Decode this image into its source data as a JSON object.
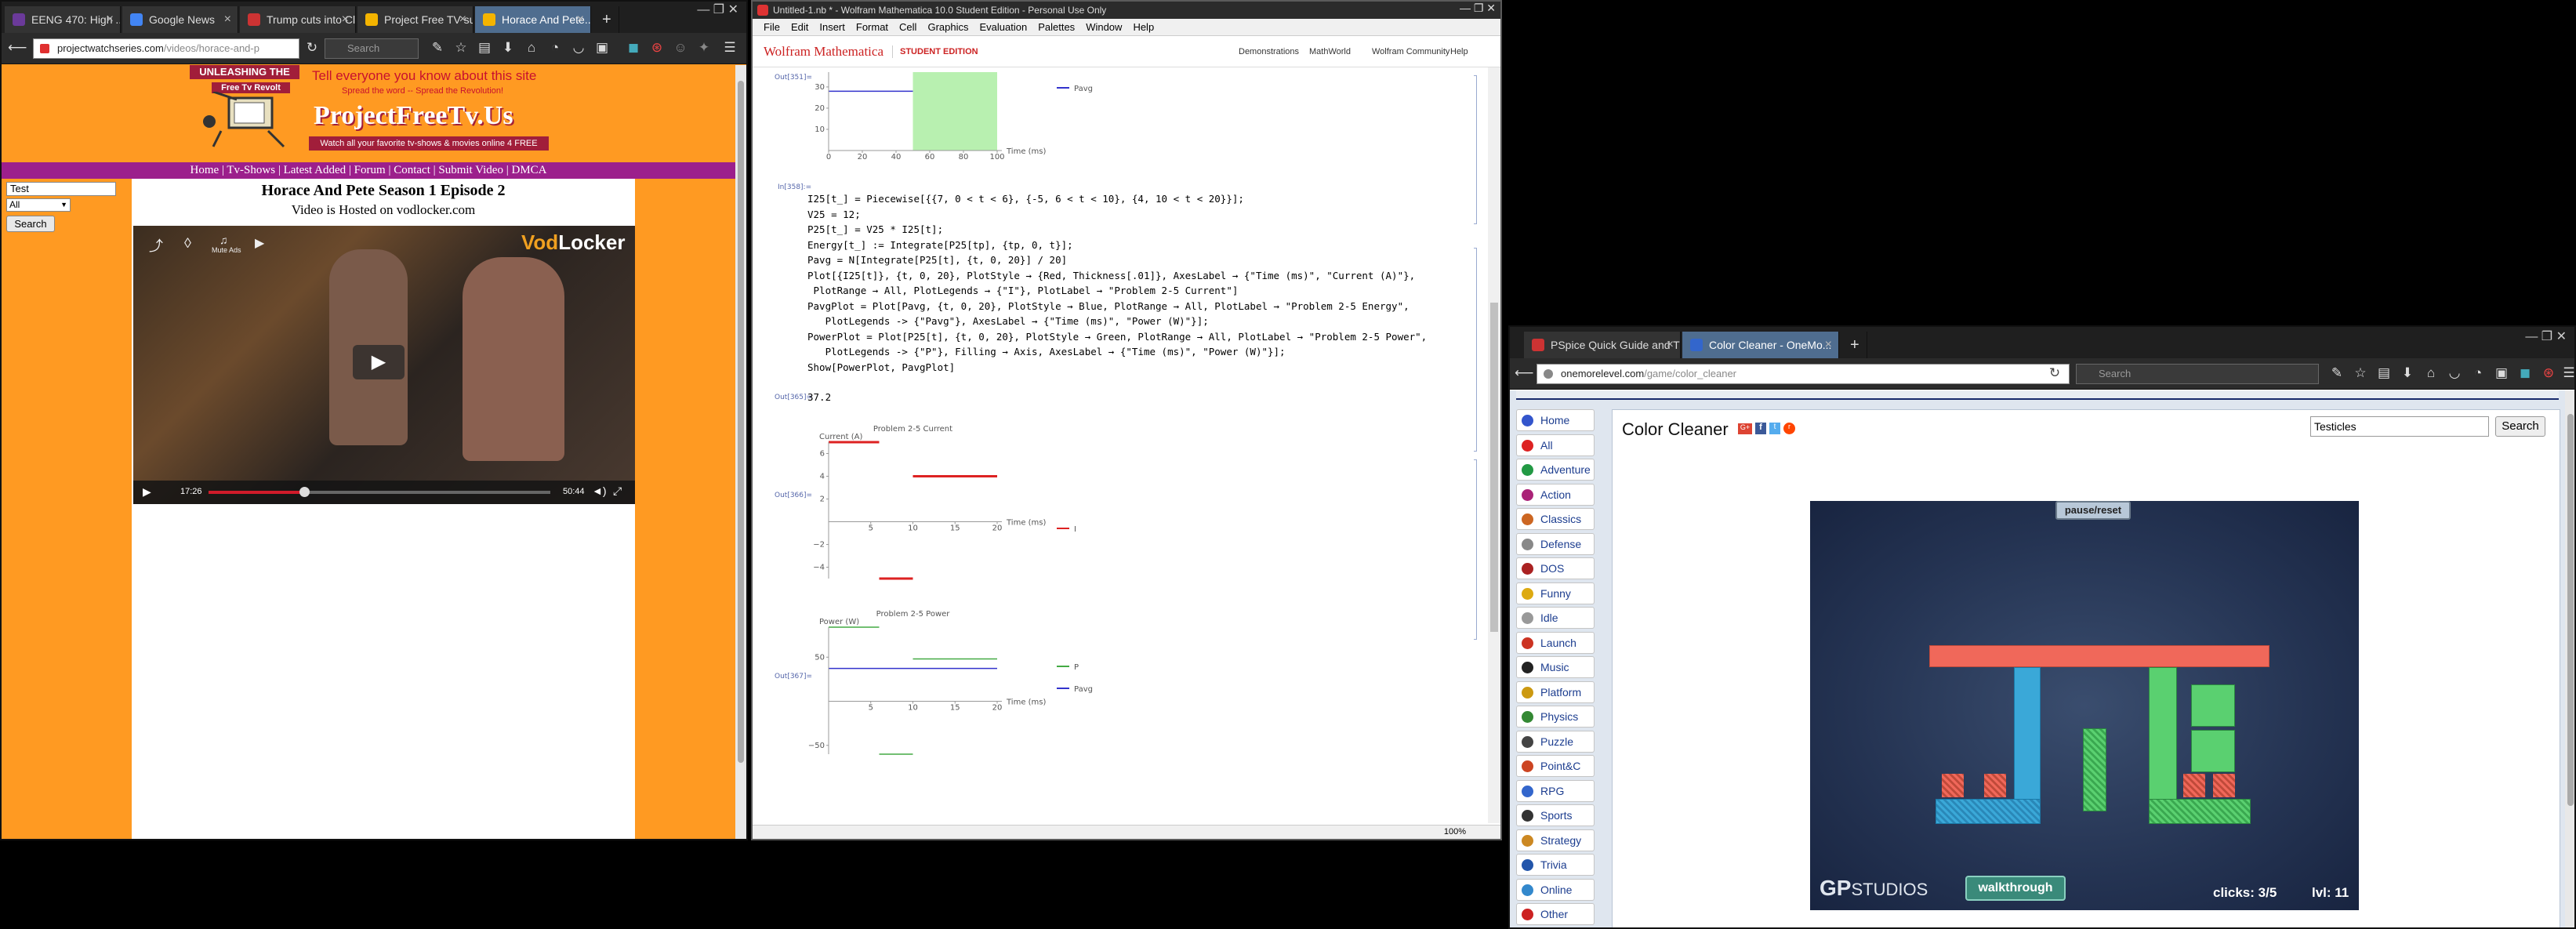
{
  "left_browser": {
    "tabs": [
      {
        "label": "EENG 470: High ...",
        "fav_color": "#6b3a9a"
      },
      {
        "label": "Google News",
        "fav_color": "#4285f4"
      },
      {
        "label": "Trump cuts into Clin...",
        "fav_color": "#cc3333"
      },
      {
        "label": "Project Free TV su...",
        "fav_color": "#f4b400"
      },
      {
        "label": "Horace And Pete...",
        "fav_color": "#f4b400"
      }
    ],
    "url_prefix": "projectwatchseries.com",
    "url_path": "/videos/horace-and-p",
    "search_placeholder": "Search",
    "site": {
      "banner_line1": "UNLEASHING THE",
      "banner_line2": "Free Tv Revolt",
      "tagline": "Tell everyone you know about this site",
      "spread": "Spread the word -- Spread the Revolution!",
      "logo": "ProjectFreeTv.Us",
      "sub": "Watch all your favorite tv-shows & movies online 4 FREE",
      "nav": [
        "Home",
        "Tv-Shows",
        "Latest Added",
        "Forum",
        "Contact",
        "Submit Video",
        "DMCA"
      ],
      "nav_sep": "|",
      "search_value": "Test",
      "select_value": "All",
      "search_button": "Search",
      "title": "Horace And Pete Season 1 Episode 2",
      "hosted": "Video is Hosted on vodlocker.com",
      "player_brand_a": "Vod",
      "player_brand_b": "Locker",
      "mute_ads": "Mute Ads",
      "time_current": "17:26",
      "time_total": "50:44",
      "progress": 0.28
    }
  },
  "mathematica": {
    "title": "Untitled-1.nb * - Wolfram Mathematica 10.0 Student Edition - Personal Use Only",
    "menu": [
      "File",
      "Edit",
      "Insert",
      "Format",
      "Cell",
      "Graphics",
      "Evaluation",
      "Palettes",
      "Window",
      "Help"
    ],
    "brand": "Wolfram Mathematica",
    "edition": "STUDENT EDITION",
    "links": [
      "Demonstrations",
      "MathWorld",
      "Wolfram Community",
      "Help"
    ],
    "labels": {
      "out351": "Out[351]=",
      "in358": "In[358]:=",
      "out365": "Out[365]=",
      "out366": "Out[366]=",
      "out367": "Out[367]="
    },
    "code_lines": [
      "I25[t_] = Piecewise[{{7, 0 < t < 6}, {-5, 6 < t < 10}, {4, 10 < t < 20}}];",
      "V25 = 12;",
      "P25[t_] = V25 * I25[t];",
      "Energy[t_] := Integrate[P25[tp], {tp, 0, t}];",
      "Pavg = N[Integrate[P25[t], {t, 0, 20}] / 20]",
      "Plot[{I25[t]}, {t, 0, 20}, PlotStyle → {Red, Thickness[.01]}, AxesLabel → {\"Time (ms)\", \"Current (A)\"},",
      " PlotRange → All, PlotLegends → {\"I\"}, PlotLabel → \"Problem 2-5 Current\"]",
      "PavgPlot = Plot[Pavg, {t, 0, 20}, PlotStyle → Blue, PlotRange → All, PlotLabel → \"Problem 2-5 Energy\",",
      "   PlotLegends -> {\"Pavg\"}, AxesLabel → {\"Time (ms)\", \"Power (W)\"}];",
      "PowerPlot = Plot[P25[t], {t, 0, 20}, PlotStyle → Green, PlotRange → All, PlotLabel → \"Problem 2-5 Power\",",
      "   PlotLegends -> {\"P\"}, Filling → Axis, AxesLabel → {\"Time (ms)\", \"Power (W)\"}];",
      "Show[PowerPlot, PavgPlot]"
    ],
    "pavg_output": "37.2",
    "zoom": "100%"
  },
  "chart_data": [
    {
      "type": "area",
      "title": "",
      "xlabel": "Time (ms)",
      "ylabel": "",
      "x_ticks": [
        0,
        20,
        40,
        60,
        80,
        100
      ],
      "y_ticks": [
        10,
        20,
        30
      ],
      "series": [
        {
          "name": "Pavg",
          "color": "#3333cc",
          "x": [
            0,
            100
          ],
          "y": [
            28,
            28
          ]
        },
        {
          "name": "",
          "color": "#b8f0b0",
          "x": [
            50,
            100
          ],
          "y": [
            37,
            37
          ]
        }
      ],
      "legend": "right"
    },
    {
      "type": "line",
      "title": "Problem 2-5 Current",
      "xlabel": "Time (ms)",
      "ylabel": "Current (A)",
      "x_ticks": [
        5,
        10,
        15,
        20
      ],
      "y_ticks": [
        -4,
        -2,
        2,
        4,
        6
      ],
      "xlim": [
        0,
        20
      ],
      "ylim": [
        -5,
        7
      ],
      "series": [
        {
          "name": "I",
          "color": "#dd2222",
          "segments": [
            [
              0,
              6,
              7
            ],
            [
              6,
              10,
              -5
            ],
            [
              10,
              20,
              4
            ]
          ]
        }
      ],
      "legend": "right"
    },
    {
      "type": "area",
      "title": "Problem 2-5 Power",
      "xlabel": "Time (ms)",
      "ylabel": "Power (W)",
      "x_ticks": [
        5,
        10,
        15,
        20
      ],
      "y_ticks": [
        -50,
        50
      ],
      "xlim": [
        0,
        20
      ],
      "ylim": [
        -60,
        84
      ],
      "series": [
        {
          "name": "P",
          "color": "#44aa44",
          "segments": [
            [
              0,
              6,
              84
            ],
            [
              6,
              10,
              -60
            ],
            [
              10,
              20,
              48
            ]
          ]
        },
        {
          "name": "Pavg",
          "color": "#3333cc",
          "segments": [
            [
              0,
              20,
              37.2
            ]
          ]
        }
      ],
      "legend": "right"
    }
  ],
  "right_browser": {
    "tabs": [
      {
        "label": "PSpice Quick Guide and Tu...",
        "fav_color": "#cc3333"
      },
      {
        "label": "Color Cleaner - OneMo...",
        "fav_color": "#3366cc"
      }
    ],
    "url_prefix": "onemorelevel.com",
    "url_path": "/game/color_cleaner",
    "search_placeholder": "Search",
    "game_title": "Color Cleaner",
    "search_value": "Testicles",
    "search_button": "Search",
    "sidebar": [
      {
        "label": "Home",
        "color": "#3355cc"
      },
      {
        "label": "All",
        "color": "#dd2222"
      },
      {
        "label": "Adventure",
        "color": "#229944"
      },
      {
        "label": "Action",
        "color": "#aa2277"
      },
      {
        "label": "Classics",
        "color": "#cc6622"
      },
      {
        "label": "Defense",
        "color": "#888888"
      },
      {
        "label": "DOS",
        "color": "#aa2222"
      },
      {
        "label": "Funny",
        "color": "#ddaa11"
      },
      {
        "label": "Idle",
        "color": "#999999"
      },
      {
        "label": "Launch",
        "color": "#cc3322"
      },
      {
        "label": "Music",
        "color": "#222222"
      },
      {
        "label": "Platform",
        "color": "#cc9911"
      },
      {
        "label": "Physics",
        "color": "#338833"
      },
      {
        "label": "Puzzle",
        "color": "#444444"
      },
      {
        "label": "Point&C",
        "color": "#cc4422"
      },
      {
        "label": "RPG",
        "color": "#3366cc"
      },
      {
        "label": "Sports",
        "color": "#333333"
      },
      {
        "label": "Strategy",
        "color": "#cc8822"
      },
      {
        "label": "Trivia",
        "color": "#2255aa"
      },
      {
        "label": "Online",
        "color": "#3388cc"
      },
      {
        "label": "Other",
        "color": "#cc2222"
      }
    ],
    "game": {
      "pause_label": "pause/reset",
      "brand_a": "GP",
      "brand_b": "STUDIOS",
      "walkthrough": "walkthrough",
      "clicks": "clicks: 3/5",
      "level": "lvl: 11"
    }
  }
}
